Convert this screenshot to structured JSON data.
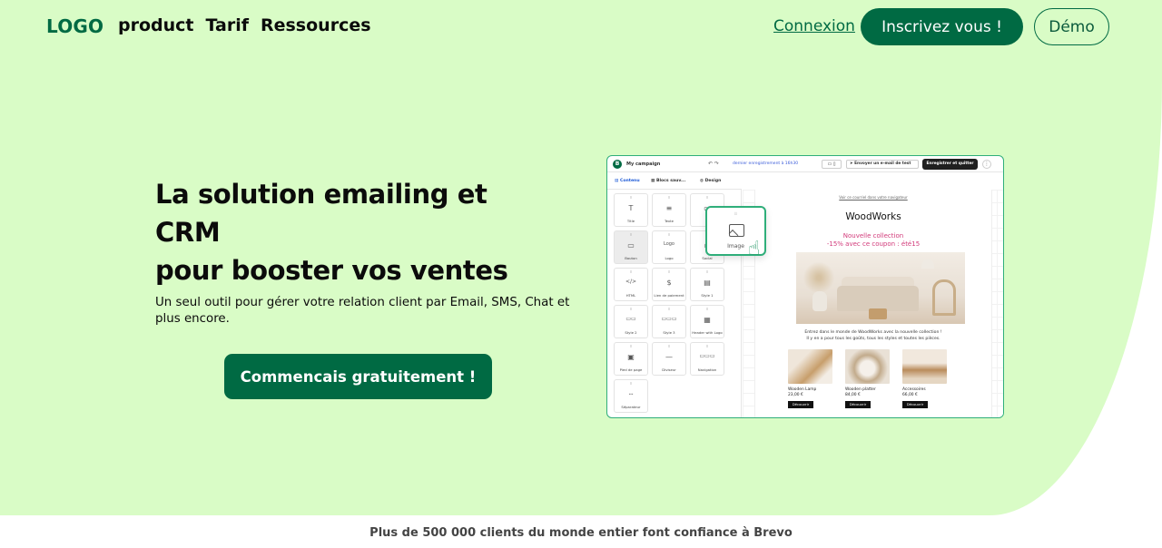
{
  "nav": {
    "logo": "LOGO",
    "links": [
      "product",
      "Tarif",
      "Ressources"
    ],
    "login": "Connexion",
    "signup": "Inscrivez vous !",
    "demo": "Démo"
  },
  "hero": {
    "title_line1": "La solution emailing et CRM",
    "title_line2": "pour booster vos ventes",
    "subtitle": "Un seul outil pour gérer votre relation client par Email, SMS, Chat et plus encore.",
    "cta": "Commencais gratuitement !"
  },
  "mockup": {
    "logo_letter": "B",
    "campaign": "My campaign",
    "saved": "dernier enregistrement à 16h30",
    "send_test": "Envoyer un e-mail de test",
    "save_quit": "Enregistrer et quitter",
    "tabs": [
      "Contenu",
      "Blocs sauv...",
      "Design"
    ],
    "tiles": [
      {
        "glyph": "T",
        "label": "Title"
      },
      {
        "glyph": "≡",
        "label": "Texte"
      },
      {
        "glyph": "▭",
        "label": ""
      },
      {
        "glyph": "▭",
        "label": "Bouton"
      },
      {
        "glyph": "Logo",
        "label": "Logo"
      },
      {
        "glyph": "◉",
        "label": "Social"
      },
      {
        "glyph": "</>",
        "label": "HTML"
      },
      {
        "glyph": "$",
        "label": "Lien de paiement"
      },
      {
        "glyph": "▤",
        "label": "Style 1"
      },
      {
        "glyph": "▭▭",
        "label": "Style 2"
      },
      {
        "glyph": "▭▭▭",
        "label": "Style 3"
      },
      {
        "glyph": "▦",
        "label": "Header with Logo"
      },
      {
        "glyph": "▣",
        "label": "Pied de page"
      },
      {
        "glyph": "—",
        "label": "Diviseur"
      },
      {
        "glyph": "▭▭▭",
        "label": "Navigation"
      },
      {
        "glyph": "┄",
        "label": "Séparateur"
      }
    ],
    "float_tile": "Image",
    "email": {
      "preheader": "Voir ce courriel dans votre navigateur",
      "brand": "WoodWorks",
      "collection_line1": "Nouvelle collection",
      "collection_line2": "-15% avec ce coupon : été15",
      "body_line1": "Entrez dans le monde de WoodWorks avec la nouvelle collection !",
      "body_line2": "Il y en a pour tous les goûts, tous les styles et toutes les pièces.",
      "products": [
        {
          "name": "Wooden Lamp",
          "price": "23,00 €",
          "button": "Découvrir"
        },
        {
          "name": "Wooden platter",
          "price": "84,00 €",
          "button": "Découvrir"
        },
        {
          "name": "Accessoires",
          "price": "66,00 €",
          "button": "Découvrir"
        }
      ]
    }
  },
  "trust": "Plus de 500 000 clients du monde entier font confiance à Brevo",
  "colors": {
    "hero_bg": "#d9fcc6",
    "brand_green": "#006a43",
    "accent_pink": "#d23a7a"
  }
}
